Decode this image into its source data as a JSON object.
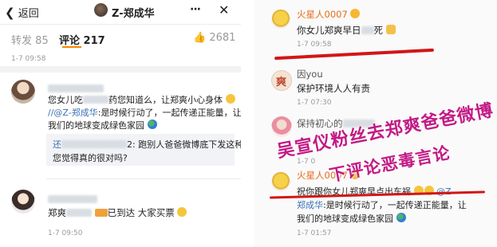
{
  "left": {
    "header": {
      "back_label": "返回",
      "account_name": "Z-郑成华",
      "more_glyph": "···"
    },
    "tabs": {
      "repost": "转发 85",
      "comments": "评论 217",
      "likes": "2681"
    },
    "post_time": "1-7 09:58",
    "comment1": {
      "text_line1_a": "您女儿吃",
      "text_line1_b": "药您知道么，让郑爽小心身体",
      "text_line2_mention": "//@Z-郑成华",
      "text_line2_rest": ":是时候行动了，一起传递正能量，让",
      "text_line3": "我们的地球变成绿色家园",
      "reply_prefix": "还",
      "reply_line1": "2: 跑别人爸爸微博底下发这种话",
      "reply_line2": "您觉得真的很对吗?"
    },
    "comment2": {
      "text_a": "郑爽",
      "text_b": "已到达 大家买票",
      "time": "1-7 09:50"
    }
  },
  "right": {
    "c1": {
      "user": "火星人0007",
      "text_a": "你女儿郑爽早日",
      "text_b": "死",
      "time": "1-7 09:58"
    },
    "c2": {
      "user": "因you",
      "text": "保护环境人人有责",
      "time": "1-7 07:30"
    },
    "c3": {
      "user": "保持初心的",
      "time": "1-7 0"
    },
    "c4": {
      "user": "火星人0007",
      "line1_a": "祝你跟你女儿郑爽早点出车祸",
      "line1_mention": "@Z-",
      "line2_mention": "郑成华",
      "line2_rest": ":是时候行动了，一起传递正能量，让",
      "line3": "我们的地球变成绿色家园",
      "time": "1-7 01:57"
    },
    "overlay_line1": "吴宣仪粉丝去郑爽爸爸微博",
    "overlay_line2": "下评论恶毒言论"
  },
  "colors": {
    "annotation_red": "#d21616",
    "overlay_magenta": "#c21a85",
    "username_orange": "#e86b18",
    "mention_blue": "#3b6fb6"
  }
}
